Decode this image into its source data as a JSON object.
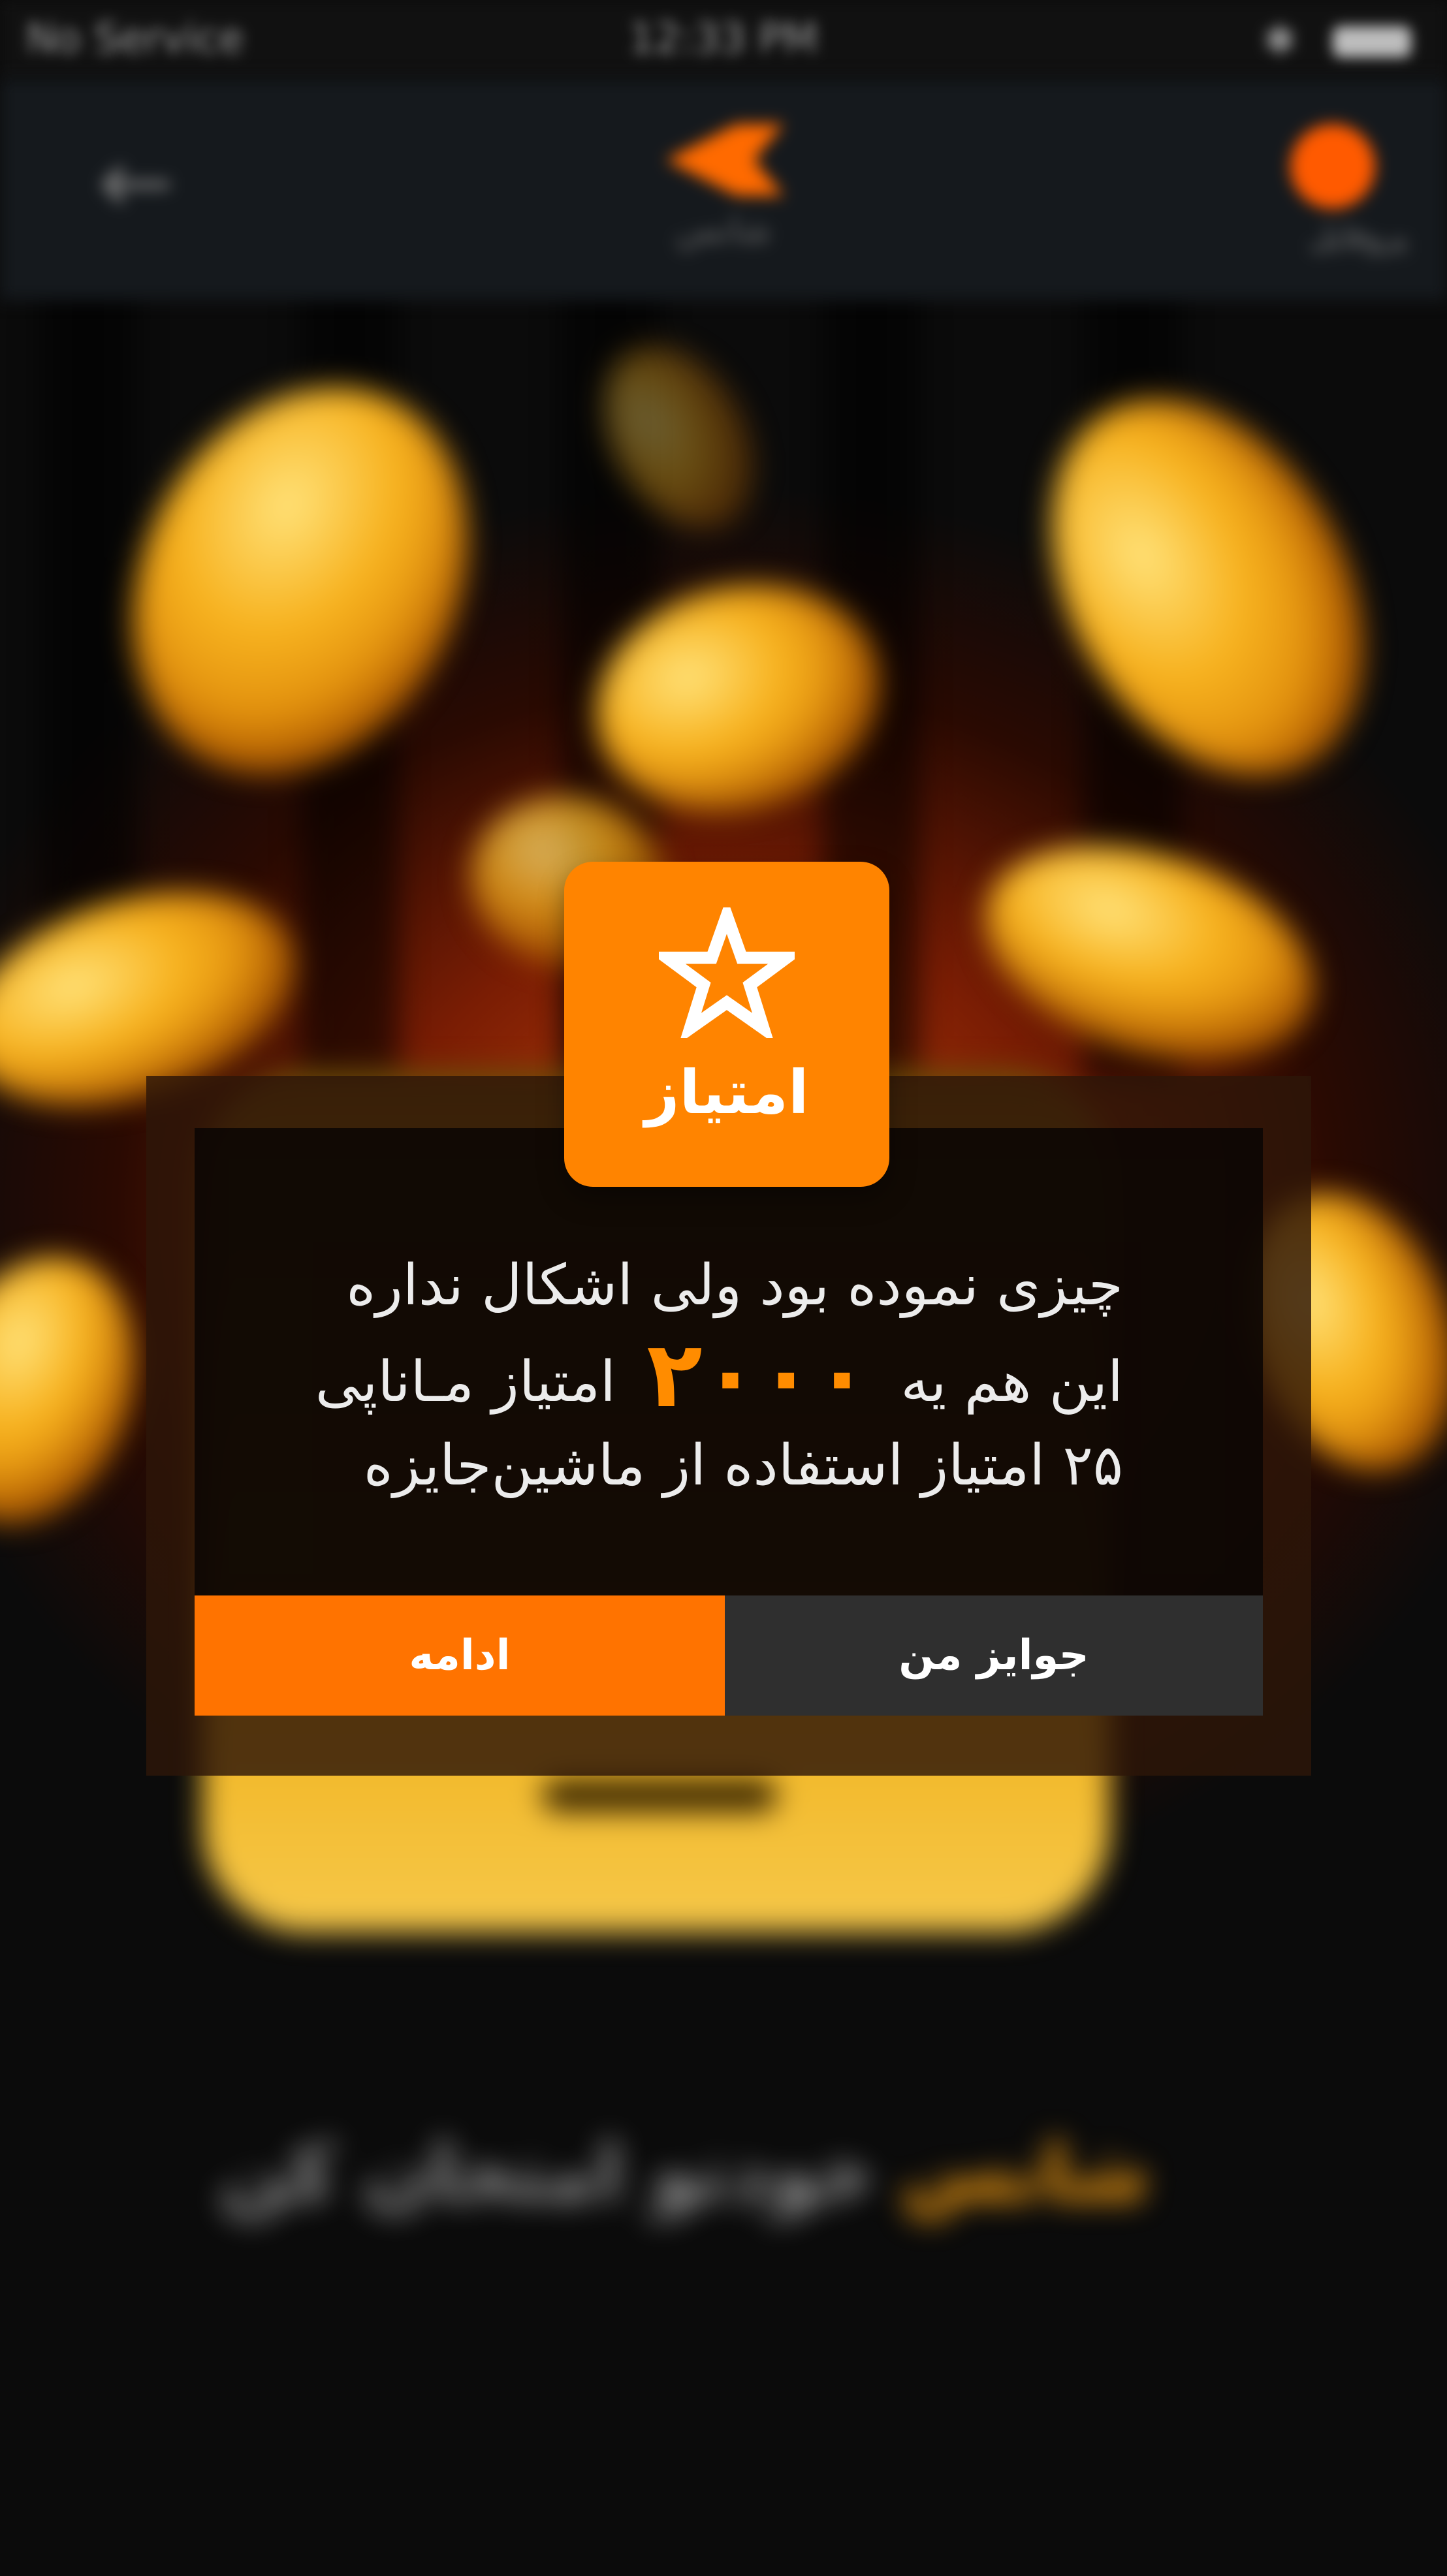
{
  "status_bar": {
    "carrier": "No Service",
    "time": "12:33 PM"
  },
  "top_nav": {
    "logo_caption": "شانس",
    "profile_label": "پروفایل"
  },
  "background": {
    "title_highlight": "شانس",
    "title_rest": "خودتو امتحان کن"
  },
  "dialog": {
    "badge_label": "امتیاز",
    "message_line1": "چیزی نموده بود ولی اشکال نداره",
    "message_line2_prefix": "این هم یه",
    "message_points": "۲۰۰۰",
    "message_line2_suffix": "امتیاز مـاناپی",
    "message_line3": "۲۵ امتیاز استفاده از ماشین‌جایزه",
    "continue_label": "ادامه",
    "my_prizes_label": "جوایز من",
    "accent_color": "#ff8400"
  }
}
